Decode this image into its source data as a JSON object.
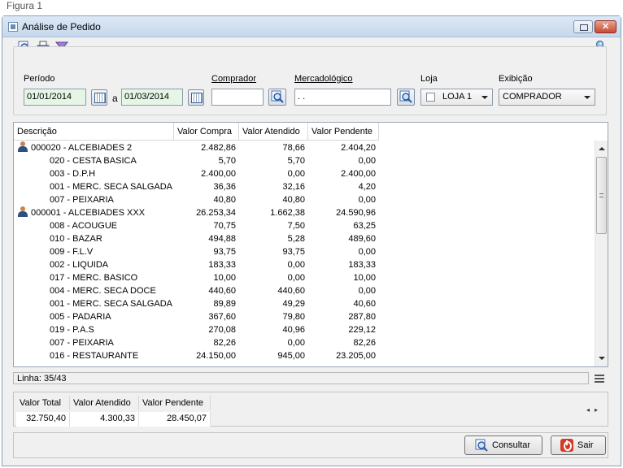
{
  "caption": "Figura 1",
  "window": {
    "title": "Análise de Pedido"
  },
  "toolbar": {
    "icons": [
      "search-icon",
      "print-icon",
      "filter-icon",
      "key-icon"
    ]
  },
  "filters": {
    "periodo_label": "Período",
    "date_from": "01/01/2014",
    "date_sep": "a",
    "date_to": "01/03/2014",
    "comprador_label": "Comprador",
    "comprador_value": "",
    "mercadologico_label": "Mercadológico",
    "mercadologico_value": " .  .",
    "loja_label": "Loja",
    "loja_value": "LOJA 1",
    "exibicao_label": "Exibição",
    "exibicao_value": "COMPRADOR"
  },
  "grid": {
    "columns": [
      "Descrição",
      "Valor Compra",
      "Valor Atendido",
      "Valor Pendente"
    ],
    "rows": [
      {
        "level": 0,
        "desc": "000020 - ALCEBIADES 2",
        "vc": "2.482,86",
        "va": "78,66",
        "vp": "2.404,20"
      },
      {
        "level": 1,
        "desc": "020 - CESTA BASICA",
        "vc": "5,70",
        "va": "5,70",
        "vp": "0,00"
      },
      {
        "level": 1,
        "desc": "003 - D.P.H",
        "vc": "2.400,00",
        "va": "0,00",
        "vp": "2.400,00"
      },
      {
        "level": 1,
        "desc": "001 - MERC. SECA SALGADA",
        "vc": "36,36",
        "va": "32,16",
        "vp": "4,20"
      },
      {
        "level": 1,
        "desc": "007 - PEIXARIA",
        "vc": "40,80",
        "va": "40,80",
        "vp": "0,00"
      },
      {
        "level": 0,
        "desc": "000001 - ALCEBIADES XXX",
        "vc": "26.253,34",
        "va": "1.662,38",
        "vp": "24.590,96"
      },
      {
        "level": 1,
        "desc": "008 - ACOUGUE",
        "vc": "70,75",
        "va": "7,50",
        "vp": "63,25"
      },
      {
        "level": 1,
        "desc": "010 - BAZAR",
        "vc": "494,88",
        "va": "5,28",
        "vp": "489,60"
      },
      {
        "level": 1,
        "desc": "009 - F.L.V",
        "vc": "93,75",
        "va": "93,75",
        "vp": "0,00"
      },
      {
        "level": 1,
        "desc": "002 - LIQUIDA",
        "vc": "183,33",
        "va": "0,00",
        "vp": "183,33"
      },
      {
        "level": 1,
        "desc": "017 - MERC.  BASICO",
        "vc": "10,00",
        "va": "0,00",
        "vp": "10,00"
      },
      {
        "level": 1,
        "desc": "004 - MERC. SECA DOCE",
        "vc": "440,60",
        "va": "440,60",
        "vp": "0,00"
      },
      {
        "level": 1,
        "desc": "001 - MERC. SECA SALGADA",
        "vc": "89,89",
        "va": "49,29",
        "vp": "40,60"
      },
      {
        "level": 1,
        "desc": "005 - PADARIA",
        "vc": "367,60",
        "va": "79,80",
        "vp": "287,80"
      },
      {
        "level": 1,
        "desc": "019 - P.A.S",
        "vc": "270,08",
        "va": "40,96",
        "vp": "229,12"
      },
      {
        "level": 1,
        "desc": "007 - PEIXARIA",
        "vc": "82,26",
        "va": "0,00",
        "vp": "82,26"
      },
      {
        "level": 1,
        "desc": "016 - RESTAURANTE",
        "vc": "24.150,00",
        "va": "945,00",
        "vp": "23.205,00"
      }
    ]
  },
  "status": {
    "linha": "Linha: 35/43"
  },
  "totals": {
    "headers": [
      "Valor Total",
      "Valor Atendido",
      "Valor Pendente"
    ],
    "values": [
      "32.750,40",
      "4.300,33",
      "28.450,07"
    ]
  },
  "footer": {
    "consultar_label": "Consultar",
    "sair_label": "Sair"
  },
  "colors": {
    "title_gradient_top": "#dce8f5",
    "field_green": "#e6f6e6",
    "close_red": "#c84a33"
  }
}
